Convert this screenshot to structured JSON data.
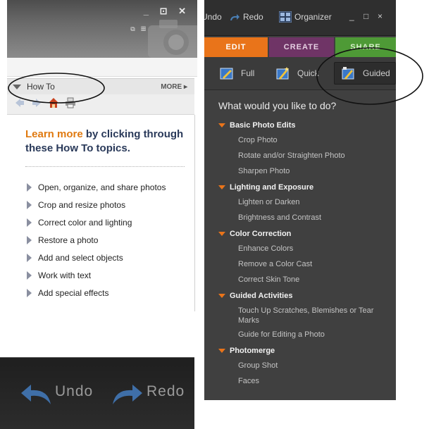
{
  "howto_panel": {
    "window_controls": "_ ⊡ ✕",
    "header_label": "How To",
    "more_label": "MORE ▸",
    "heading_accent": "Learn more",
    "heading_rest": " by clicking through these How To topics.",
    "topics": [
      "Open, organize, and share photos",
      "Crop and resize photos",
      "Correct color and lighting",
      "Restore a photo",
      "Add and select objects",
      "Work with text",
      "Add special effects"
    ],
    "toolbar_icons": [
      "back-arrow-icon",
      "forward-arrow-icon",
      "home-icon",
      "print-icon"
    ]
  },
  "edit_panel": {
    "undo_label": "Undo",
    "redo_label": "Redo",
    "organizer_label": "Organizer",
    "win_min": "_",
    "win_max": "□",
    "win_close": "×",
    "tabs": {
      "edit": "EDIT",
      "create": "CREATE",
      "share": "SHARE"
    },
    "tab_colors": {
      "edit": "#e9741a",
      "create": "#6f3466",
      "share": "#4e9a36"
    },
    "modes": {
      "full": "Full",
      "quick": "Quick",
      "guided": "Guided"
    },
    "question": "What would you like to do?",
    "categories": [
      {
        "title": "Basic Photo Edits",
        "items": [
          "Crop Photo",
          "Rotate and/or Straighten Photo",
          "Sharpen Photo"
        ]
      },
      {
        "title": "Lighting and Exposure",
        "items": [
          "Lighten or Darken",
          "Brightness and Contrast"
        ]
      },
      {
        "title": "Color Correction",
        "items": [
          "Enhance Colors",
          "Remove a Color Cast",
          "Correct Skin Tone"
        ]
      },
      {
        "title": "Guided Activities",
        "items": [
          "Touch Up Scratches, Blemishes or Tear Marks",
          "Guide for Editing a Photo"
        ]
      },
      {
        "title": "Photomerge",
        "items": [
          "Group Shot",
          "Faces"
        ]
      }
    ]
  },
  "undo_crop": {
    "undo_label": "Undo",
    "redo_label": "Redo"
  },
  "colors": {
    "accent_orange": "#e07a10",
    "annotation": "#111111"
  }
}
